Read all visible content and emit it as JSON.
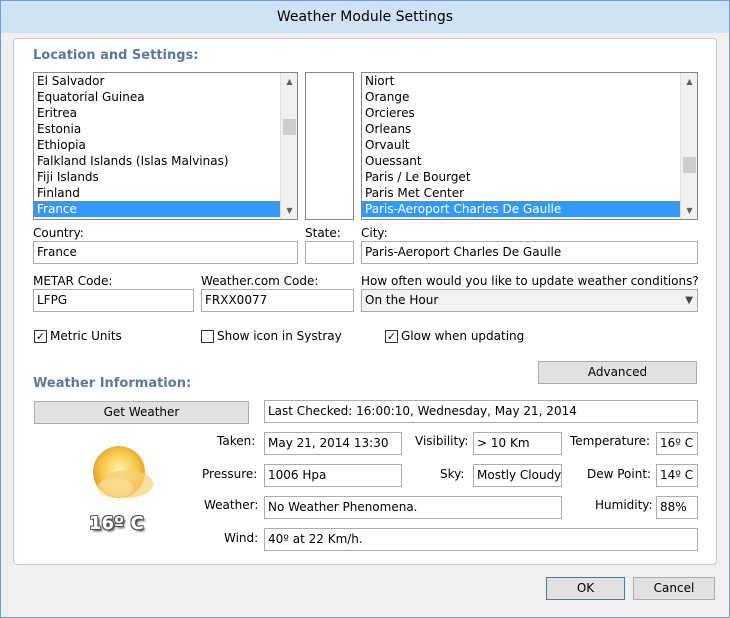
{
  "window": {
    "title": "Weather Module Settings"
  },
  "location_section": {
    "title": "Location and Settings:"
  },
  "countries": {
    "items": [
      "El Salvador",
      "Equatorial Guinea",
      "Eritrea",
      "Estonia",
      "Ethiopia",
      "Falkland Islands (Islas Malvinas)",
      "Fiji Islands",
      "Finland",
      "France"
    ],
    "selected": "France"
  },
  "cities": {
    "items": [
      "Niort",
      "Orange",
      "Orcieres",
      "Orleans",
      "Orvault",
      "Ouessant",
      "Paris / Le Bourget",
      "Paris Met Center",
      "Paris-Aeroport Charles De Gaulle"
    ],
    "selected": "Paris-Aeroport Charles De Gaulle"
  },
  "country": {
    "label": "Country:",
    "value": "France"
  },
  "state": {
    "label": "State:",
    "value": ""
  },
  "city": {
    "label": "City:",
    "value": "Paris-Aeroport Charles De Gaulle"
  },
  "metar": {
    "label": "METAR Code:",
    "value": "LFPG"
  },
  "weathercom": {
    "label": "Weather.com Code:",
    "value": "FRXX0077"
  },
  "update": {
    "label": "How often would you like to update weather conditions?",
    "value": "On the Hour"
  },
  "options": {
    "metric": {
      "label": "Metric Units",
      "checked": true
    },
    "systray": {
      "label": "Show icon in Systray",
      "checked": false
    },
    "glow": {
      "label": "Glow when updating",
      "checked": true
    }
  },
  "advanced_label": "Advanced",
  "weather_section": {
    "title": "Weather Information:"
  },
  "get_weather_label": "Get Weather",
  "last_checked": "Last Checked: 16:00:10, Wednesday, May 21, 2014",
  "big_temp": "16º C",
  "info": {
    "taken": {
      "label": "Taken:",
      "value": "May 21, 2014 13:30"
    },
    "visibility": {
      "label": "Visibility:",
      "value": "> 10 Km"
    },
    "temperature": {
      "label": "Temperature:",
      "value": "16º C"
    },
    "pressure": {
      "label": "Pressure:",
      "value": "1006 Hpa"
    },
    "sky": {
      "label": "Sky:",
      "value": "Mostly Cloudy."
    },
    "dewpoint": {
      "label": "Dew Point:",
      "value": "14º C"
    },
    "weather": {
      "label": "Weather:",
      "value": "No Weather Phenomena."
    },
    "humidity": {
      "label": "Humidity:",
      "value": "88%"
    },
    "wind": {
      "label": "Wind:",
      "value": "40º at 22 Km/h."
    }
  },
  "footer": {
    "ok_label": "OK",
    "cancel_label": "Cancel"
  },
  "colors": {
    "selection": "#3399ff",
    "section_title": "#5b7a9a"
  },
  "icons": {
    "weather": "partly-cloudy-icon",
    "check": "checkmark-icon",
    "dropdown": "chevron-down-icon"
  }
}
